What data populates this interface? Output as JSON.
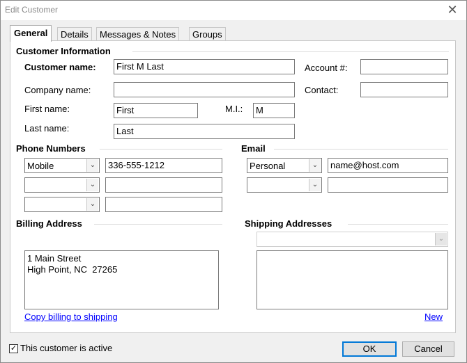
{
  "window": {
    "title": "Edit Customer",
    "close_glyph": "✕"
  },
  "tabs": [
    "General",
    "Details",
    "Messages & Notes",
    "Groups"
  ],
  "customer_info": {
    "section": "Customer Information",
    "customer_name_label": "Customer name:",
    "customer_name": "First M Last",
    "account_label": "Account #:",
    "account": "",
    "company_label": "Company name:",
    "company": "",
    "contact_label": "Contact:",
    "contact": "",
    "first_label": "First name:",
    "first": "First",
    "mi_label": "M.I.:",
    "mi": "M",
    "last_label": "Last name:",
    "last": "Last"
  },
  "phones": {
    "section": "Phone Numbers",
    "rows": [
      {
        "type": "Mobile",
        "number": "336-555-1212"
      },
      {
        "type": "",
        "number": ""
      },
      {
        "type": "",
        "number": ""
      }
    ]
  },
  "email": {
    "section": "Email",
    "rows": [
      {
        "type": "Personal",
        "address": "name@host.com"
      },
      {
        "type": "",
        "address": ""
      }
    ]
  },
  "billing": {
    "section": "Billing Address",
    "line1": "1 Main Street",
    "line2": "High Point, NC  27265",
    "copy_link": "Copy billing to shipping"
  },
  "shipping": {
    "section": "Shipping Addresses",
    "selected": "",
    "new_link": "New"
  },
  "footer": {
    "active_label": "This customer is active",
    "active_checked": true,
    "check_glyph": "✓",
    "ok": "OK",
    "cancel": "Cancel"
  },
  "icons": {
    "dropdown": "chevron-down-icon",
    "close": "close-icon",
    "check": "checkmark-icon"
  }
}
